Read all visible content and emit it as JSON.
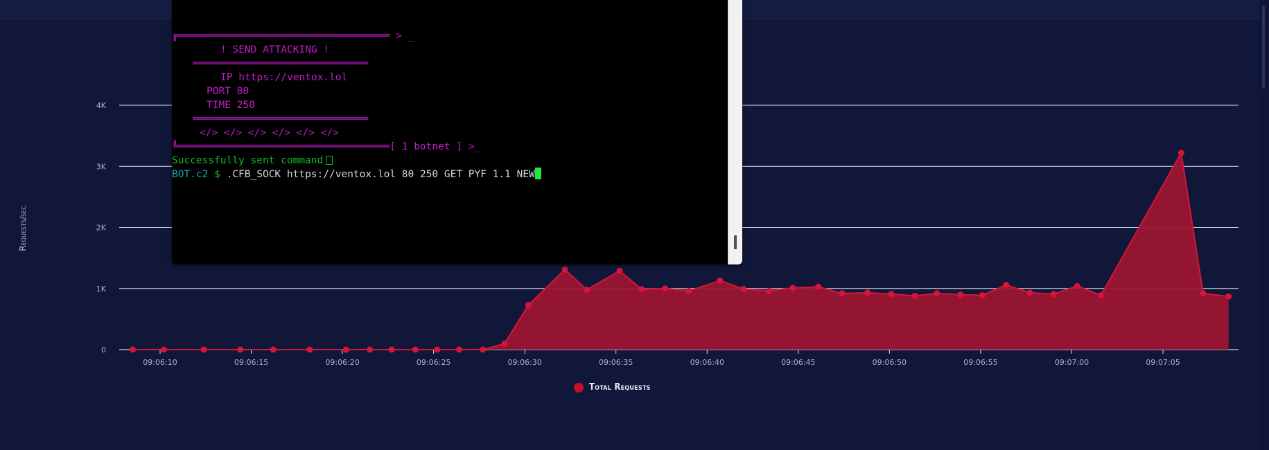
{
  "terminal": {
    "banner_top_suffix": " > _",
    "title": "! SEND ATTACKING !",
    "ip_label": "IP",
    "ip_value": "https://ventox.lol",
    "port_label": "PORT",
    "port_value": "80",
    "time_label": "TIME",
    "time_value": "250",
    "code_tags": "</> </> </> </> </> </>",
    "botnet_suffix": "[ 1 botnet ] >_",
    "success_message": "Successfully sent command",
    "prompt_host": "BOT.c2",
    "prompt_symbol": "$",
    "command": ".CFB_SOCK https://ventox.lol 80 250 GET PYF 1.1 NEW"
  },
  "chart": {
    "ylabel": "Requests/sec",
    "legend_label": "Total Requests",
    "colors": {
      "area": "#9b1530",
      "line": "#d4163a",
      "point": "#d4163a",
      "grid": "#d8dcf0",
      "tick_text": "#aab0cf",
      "background": "#111738"
    }
  },
  "chart_data": {
    "type": "area",
    "title": "",
    "ylabel": "Requests/sec",
    "xlabel": "",
    "ylim": [
      0,
      4000
    ],
    "y_ticks": [
      0,
      1000,
      2000,
      3000,
      4000
    ],
    "y_tick_labels": [
      "0",
      "1K",
      "2K",
      "3K",
      "4K"
    ],
    "x_tick_labels": [
      "09:06:10",
      "09:06:15",
      "09:06:20",
      "09:06:25",
      "09:06:30",
      "09:06:35",
      "09:06:40",
      "09:06:45",
      "09:06:50",
      "09:06:55",
      "09:07:00",
      "09:07:05"
    ],
    "series": [
      {
        "name": "Total Requests",
        "x": [
          "09:06:08.5",
          "09:06:10.2",
          "09:06:12.4",
          "09:06:14.4",
          "09:06:16.2",
          "09:06:18.2",
          "09:06:20.2",
          "09:06:21.5",
          "09:06:22.7",
          "09:06:24.0",
          "09:06:25.2",
          "09:06:26.4",
          "09:06:27.7",
          "09:06:28.9",
          "09:06:30.2",
          "09:06:32.2",
          "09:06:33.4",
          "09:06:35.2",
          "09:06:36.4",
          "09:06:37.7",
          "09:06:39.0",
          "09:06:40.7",
          "09:06:42.0",
          "09:06:43.4",
          "09:06:44.7",
          "09:06:46.1",
          "09:06:47.4",
          "09:06:48.8",
          "09:06:50.1",
          "09:06:51.4",
          "09:06:52.6",
          "09:06:53.9",
          "09:06:55.1",
          "09:06:56.4",
          "09:06:57.7",
          "09:06:59.0",
          "09:07:00.3",
          "09:07:01.6",
          "09:07:06.0",
          "09:07:07.2",
          "09:07:08.6"
        ],
        "values": [
          0,
          0,
          0,
          0,
          0,
          0,
          0,
          0,
          0,
          0,
          0,
          0,
          0,
          100,
          730,
          1310,
          980,
          1290,
          990,
          1000,
          960,
          1130,
          990,
          960,
          1010,
          1030,
          920,
          930,
          910,
          880,
          920,
          900,
          890,
          1060,
          930,
          910,
          1040,
          890,
          3220,
          920,
          870
        ]
      }
    ],
    "grid": true,
    "legend_position": "bottom-center"
  }
}
